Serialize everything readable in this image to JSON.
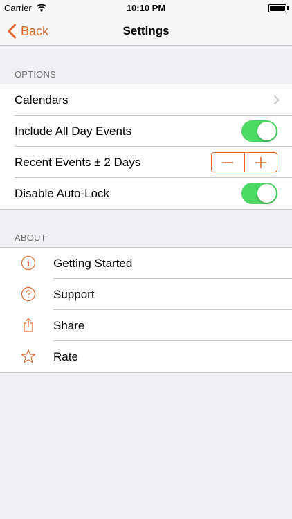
{
  "status_bar": {
    "carrier": "Carrier",
    "time": "10:10 PM"
  },
  "nav": {
    "back_label": "Back",
    "title": "Settings"
  },
  "colors": {
    "accent": "#e0692b",
    "toggle_on": "#4cd964",
    "background": "#efeff4",
    "separator": "#c8c7cc"
  },
  "options": {
    "header": "OPTIONS",
    "calendars": "Calendars",
    "all_day": "Include All Day Events",
    "recent": "Recent Events ± 2 Days",
    "auto_lock": "Disable Auto-Lock"
  },
  "about": {
    "header": "ABOUT",
    "items": [
      {
        "label": "Getting Started",
        "icon": "info-icon"
      },
      {
        "label": "Support",
        "icon": "question-icon"
      },
      {
        "label": "Share",
        "icon": "share-icon"
      },
      {
        "label": "Rate",
        "icon": "star-icon"
      }
    ]
  }
}
